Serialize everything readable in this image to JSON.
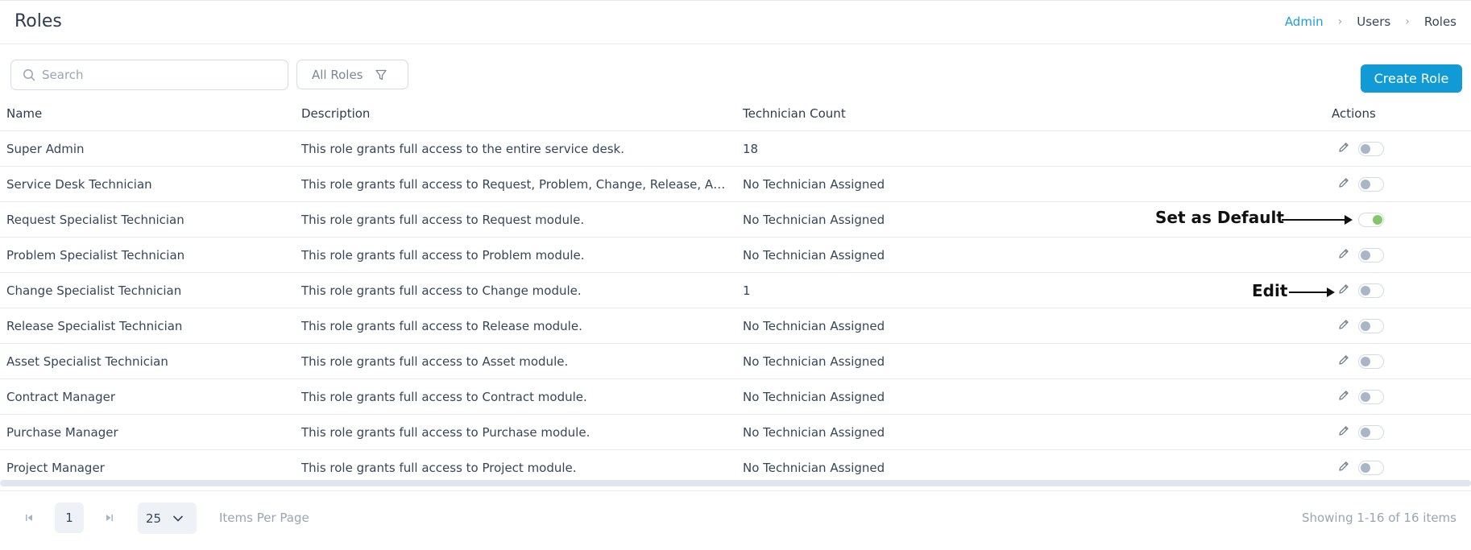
{
  "page": {
    "title": "Roles"
  },
  "breadcrumb": [
    {
      "label": "Admin",
      "link": true
    },
    {
      "label": "Users",
      "link": false
    },
    {
      "label": "Roles",
      "link": false
    }
  ],
  "toolbar": {
    "search_placeholder": "Search",
    "filter_label": "All Roles",
    "create_label": "Create Role"
  },
  "table": {
    "headers": {
      "name": "Name",
      "description": "Description",
      "count": "Technician Count",
      "actions": "Actions"
    },
    "rows": [
      {
        "name": "Super Admin",
        "description": "This role grants full access to the entire service desk.",
        "count": "18",
        "default": false,
        "show_edit": true
      },
      {
        "name": "Service Desk Technician",
        "description": "This role grants full access to Request, Problem, Change, Release, Asset, Contract, Purchase and Project modules.",
        "count": "No Technician Assigned",
        "default": false,
        "show_edit": true
      },
      {
        "name": "Request Specialist Technician",
        "description": "This role grants full access to Request module.",
        "count": "No Technician Assigned",
        "default": true,
        "show_edit": false
      },
      {
        "name": "Problem Specialist Technician",
        "description": "This role grants full access to Problem module.",
        "count": "No Technician Assigned",
        "default": false,
        "show_edit": true
      },
      {
        "name": "Change Specialist Technician",
        "description": "This role grants full access to Change module.",
        "count": "1",
        "default": false,
        "show_edit": true
      },
      {
        "name": "Release Specialist Technician",
        "description": "This role grants full access to Release module.",
        "count": "No Technician Assigned",
        "default": false,
        "show_edit": true
      },
      {
        "name": "Asset Specialist Technician",
        "description": "This role grants full access to Asset module.",
        "count": "No Technician Assigned",
        "default": false,
        "show_edit": true
      },
      {
        "name": "Contract Manager",
        "description": "This role grants full access to Contract module.",
        "count": "No Technician Assigned",
        "default": false,
        "show_edit": true
      },
      {
        "name": "Purchase Manager",
        "description": "This role grants full access to Purchase module.",
        "count": "No Technician Assigned",
        "default": false,
        "show_edit": true
      },
      {
        "name": "Project Manager",
        "description": "This role grants full access to Project module.",
        "count": "No Technician Assigned",
        "default": false,
        "show_edit": true
      }
    ]
  },
  "annotations": {
    "set_default": "Set as Default",
    "edit": "Edit"
  },
  "pagination": {
    "current_page": "1",
    "per_page": "25",
    "per_page_label": "Items Per Page",
    "showing": "Showing 1-16 of 16 items"
  },
  "colors": {
    "accent": "#109ad6",
    "link": "#1a9fd6",
    "toggle_on": "#86c66a",
    "toggle_off": "#a8b6c8"
  }
}
